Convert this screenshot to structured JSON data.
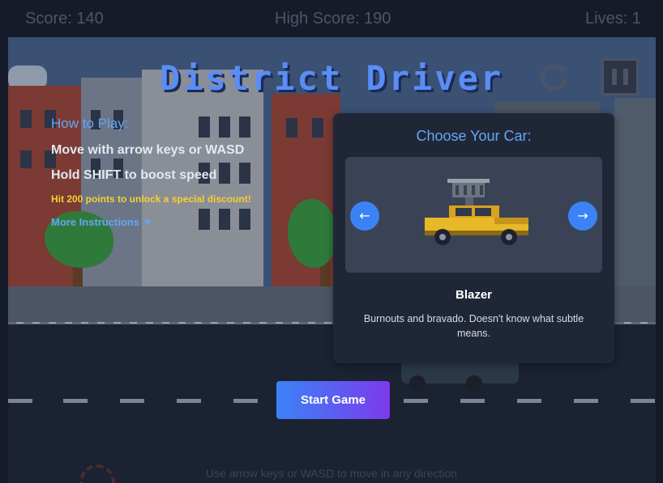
{
  "hud": {
    "score": "Score: 140",
    "high_score": "High Score: 190",
    "lives": "Lives: 1"
  },
  "title": "District Driver",
  "instructions": {
    "heading": "How to Play:",
    "line1": "Move with arrow keys or WASD",
    "line2": "Hold SHIFT to boost speed",
    "promo": "Hit 200 points to unlock a special discount!",
    "more": "More Instructions ▼"
  },
  "car_select": {
    "heading": "Choose Your Car:",
    "prev": "←",
    "next": "→",
    "car_name": "Blazer",
    "car_description": "Burnouts and bravado. Doesn't know what subtle means."
  },
  "start_button": "Start Game",
  "hint": "Use arrow keys or WASD to move in any direction",
  "colors": {
    "accent": "#3b82f6",
    "title": "#5a8df5",
    "promo": "#f5d033",
    "button_gradient_end": "#7c3aed"
  },
  "icons": {
    "restart": "restart-icon",
    "pause": "pause-icon",
    "dropdown": "triangle-down-icon"
  }
}
